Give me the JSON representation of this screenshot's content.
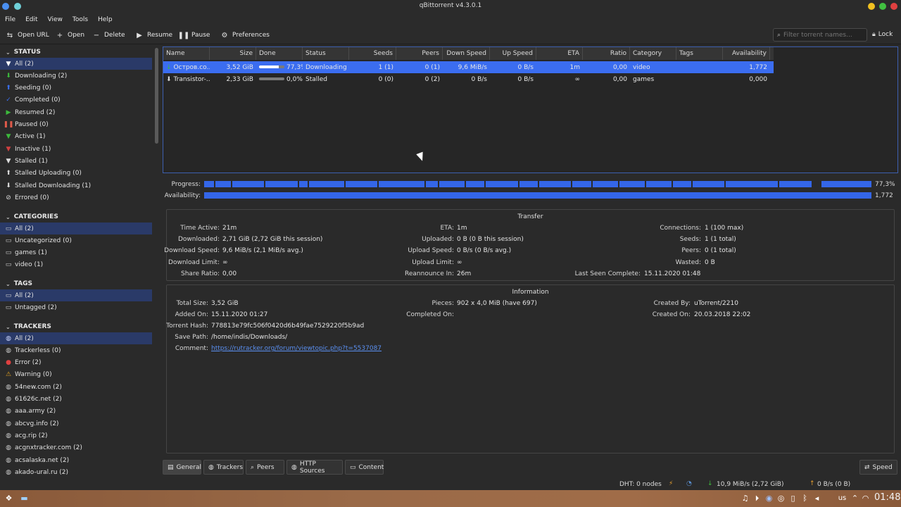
{
  "window": {
    "title": "qBittorrent v4.3.0.1"
  },
  "menu": [
    "File",
    "Edit",
    "View",
    "Tools",
    "Help"
  ],
  "toolbar": {
    "open_url": "Open URL",
    "open": "Open",
    "delete": "Delete",
    "resume": "Resume",
    "pause": "Pause",
    "preferences": "Preferences",
    "search_placeholder": "Filter torrent names...",
    "lock": "Lock"
  },
  "sidebar": {
    "status_title": "STATUS",
    "status": [
      {
        "label": "All (2)",
        "icon": "funnel-icon",
        "color": "#ffffff"
      },
      {
        "label": "Downloading (2)",
        "icon": "down-arrow-icon",
        "color": "#3cba3c"
      },
      {
        "label": "Seeding (0)",
        "icon": "up-arrow-icon",
        "color": "#3a6ff0"
      },
      {
        "label": "Completed (0)",
        "icon": "check-icon",
        "color": "#3a6ff0"
      },
      {
        "label": "Resumed (2)",
        "icon": "play-icon",
        "color": "#3cba3c"
      },
      {
        "label": "Paused (0)",
        "icon": "pause-icon",
        "color": "#e05a4a"
      },
      {
        "label": "Active (1)",
        "icon": "funnel-icon",
        "color": "#3cba3c"
      },
      {
        "label": "Inactive (1)",
        "icon": "funnel-icon",
        "color": "#d04040"
      },
      {
        "label": "Stalled (1)",
        "icon": "funnel-icon",
        "color": "#dddddd"
      },
      {
        "label": "Stalled Uploading (0)",
        "icon": "up-arrow-icon",
        "color": "#dddddd"
      },
      {
        "label": "Stalled Downloading (1)",
        "icon": "down-arrow-icon",
        "color": "#dddddd"
      },
      {
        "label": "Errored (0)",
        "icon": "error-circle-icon",
        "color": "#dddddd"
      }
    ],
    "categories_title": "CATEGORIES",
    "categories": [
      "All (2)",
      "Uncategorized (0)",
      "games (1)",
      "video (1)"
    ],
    "tags_title": "TAGS",
    "tags": [
      "All (2)",
      "Untagged (2)"
    ],
    "trackers_title": "TRACKERS",
    "trackers": [
      {
        "label": "All (2)",
        "icon": "globe-icon",
        "color": "#cfd8ff"
      },
      {
        "label": "Trackerless (0)",
        "icon": "globe-icon",
        "color": "#cccccc"
      },
      {
        "label": "Error (2)",
        "icon": "error-icon",
        "color": "#e04040"
      },
      {
        "label": "Warning (0)",
        "icon": "warning-icon",
        "color": "#e0a020"
      },
      {
        "label": "54new.com (2)",
        "icon": "globe-icon",
        "color": "#cccccc"
      },
      {
        "label": "61626c.net (2)",
        "icon": "globe-icon",
        "color": "#cccccc"
      },
      {
        "label": "aaa.army (2)",
        "icon": "globe-icon",
        "color": "#cccccc"
      },
      {
        "label": "abcvg.info (2)",
        "icon": "globe-icon",
        "color": "#cccccc"
      },
      {
        "label": "acg.rip (2)",
        "icon": "globe-icon",
        "color": "#cccccc"
      },
      {
        "label": "acgnxtracker.com (2)",
        "icon": "globe-icon",
        "color": "#cccccc"
      },
      {
        "label": "acsalaska.net (2)",
        "icon": "globe-icon",
        "color": "#cccccc"
      },
      {
        "label": "akado-ural.ru (2)",
        "icon": "globe-icon",
        "color": "#cccccc"
      }
    ]
  },
  "table": {
    "headers": [
      "Name",
      "Size",
      "Done",
      "Status",
      "Seeds",
      "Peers",
      "Down Speed",
      "Up Speed",
      "ETA",
      "Ratio",
      "Category",
      "Tags",
      "Availability"
    ],
    "rows": [
      {
        "name": "Остров.со...",
        "size": "3,52 GiB",
        "done": "77,3%",
        "done_fraction": 0.773,
        "status": "Downloading",
        "seeds": "1 (1)",
        "peers": "0 (1)",
        "down": "9,6 MiB/s",
        "up": "0 B/s",
        "eta": "1m",
        "ratio": "0,00",
        "category": "video",
        "tags": "",
        "availability": "1,772"
      },
      {
        "name": "Transistor-...",
        "size": "2,33 GiB",
        "done": "0,0%",
        "done_fraction": 0.0,
        "status": "Stalled",
        "seeds": "0 (0)",
        "peers": "0 (2)",
        "down": "0 B/s",
        "up": "0 B/s",
        "eta": "∞",
        "ratio": "0,00",
        "category": "games",
        "tags": "",
        "availability": "0,000"
      }
    ]
  },
  "bars": {
    "progress_label": "Progress:",
    "progress_value": "77,3%",
    "availability_label": "Availability:",
    "availability_value": "1,772"
  },
  "transfer": {
    "title": "Transfer",
    "time_active_label": "Time Active:",
    "time_active": "21m",
    "downloaded_label": "Downloaded:",
    "downloaded": "2,71 GiB (2,72 GiB this session)",
    "down_speed_label": "Download Speed:",
    "down_speed": "9,6 MiB/s (2,1 MiB/s avg.)",
    "down_limit_label": "Download Limit:",
    "down_limit": "∞",
    "share_ratio_label": "Share Ratio:",
    "share_ratio": "0,00",
    "eta_label": "ETA:",
    "eta": "1m",
    "uploaded_label": "Uploaded:",
    "uploaded": "0 B (0 B this session)",
    "up_speed_label": "Upload Speed:",
    "up_speed": "0 B/s (0 B/s avg.)",
    "up_limit_label": "Upload Limit:",
    "up_limit": "∞",
    "reannounce_label": "Reannounce In:",
    "reannounce": "26m",
    "connections_label": "Connections:",
    "connections": "1 (100 max)",
    "seeds_label": "Seeds:",
    "seeds": "1 (1 total)",
    "peers_label": "Peers:",
    "peers": "0 (1 total)",
    "wasted_label": "Wasted:",
    "wasted": "0 B",
    "last_seen_label": "Last Seen Complete:",
    "last_seen": "15.11.2020 01:48"
  },
  "information": {
    "title": "Information",
    "total_size_label": "Total Size:",
    "total_size": "3,52 GiB",
    "added_on_label": "Added On:",
    "added_on": "15.11.2020 01:27",
    "hash_label": "Torrent Hash:",
    "hash": "778813e79fc506f0420d6b49fae7529220f5b9ad",
    "save_path_label": "Save Path:",
    "save_path": "/home/indis/Downloads/",
    "comment_label": "Comment:",
    "comment": "https://rutracker.org/forum/viewtopic.php?t=5537087",
    "pieces_label": "Pieces:",
    "pieces": "902 x 4,0 MiB (have 697)",
    "completed_on_label": "Completed On:",
    "completed_on": "",
    "created_by_label": "Created By:",
    "created_by": "uTorrent/2210",
    "created_on_label": "Created On:",
    "created_on": "20.03.2018 22:02"
  },
  "tabs": [
    "General",
    "Trackers",
    "Peers",
    "HTTP Sources",
    "Content"
  ],
  "speed_button": "Speed",
  "statusbar": {
    "dht": "DHT: 0 nodes",
    "down": "10,9 MiB/s (2,72 GiB)",
    "up": "0 B/s (0 B)"
  },
  "taskbar": {
    "keyboard": "us",
    "clock": "01:48"
  },
  "colors": {
    "accent": "#3b6df0",
    "selection": "#2a3a68",
    "background": "#2a2a2a"
  }
}
